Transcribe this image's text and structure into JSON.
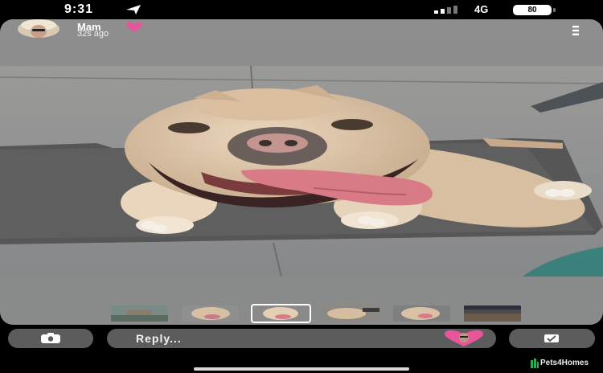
{
  "status_bar": {
    "time": "9:31",
    "network": "4G",
    "battery": "80"
  },
  "story": {
    "sender_name": "Mam",
    "time_ago": "32s ago",
    "thumbnail_count": 6,
    "selected_thumbnail": 3
  },
  "reply": {
    "placeholder": "Reply..."
  },
  "watermark": "Pets4Homes",
  "icons": [
    "location-arrow-icon",
    "signal-icon",
    "battery-icon",
    "heart-icon",
    "menu-icon",
    "camera-icon",
    "send-icon",
    "pets4homes-logo-icon"
  ],
  "colors": {
    "accent_pink": "#e8559a",
    "button_grey": "#5c5c5c"
  }
}
